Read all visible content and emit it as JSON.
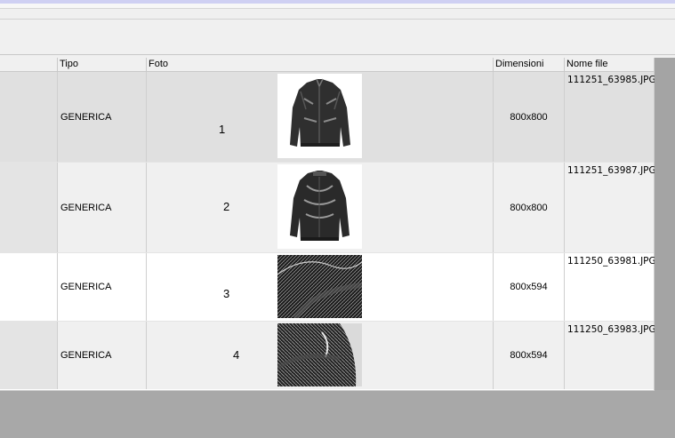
{
  "columns": {
    "tipo": "Tipo",
    "foto": "Foto",
    "dimensioni": "Dimensioni",
    "nome_file": "Nome file"
  },
  "rows": [
    {
      "tipo": "GENERICA",
      "number": "1",
      "dimensioni": "800x800",
      "nome_file": "111251_63985.JPG",
      "image": "jacket-front-icon"
    },
    {
      "tipo": "GENERICA",
      "number": "2",
      "dimensioni": "800x800",
      "nome_file": "111251_63987.JPG",
      "image": "jacket-back-icon"
    },
    {
      "tipo": "GENERICA",
      "number": "3",
      "dimensioni": "800x594",
      "nome_file": "111250_63981.JPG",
      "image": "fabric-detail-icon"
    },
    {
      "tipo": "GENERICA",
      "number": "4",
      "dimensioni": "800x594",
      "nome_file": "111250_63983.JPG",
      "image": "fabric-closeup-icon"
    }
  ],
  "colors": {
    "selected_row": "#e0e0e0",
    "alt_row": "#f0f0f0",
    "row": "#ffffff",
    "background": "#a8a8a8"
  }
}
